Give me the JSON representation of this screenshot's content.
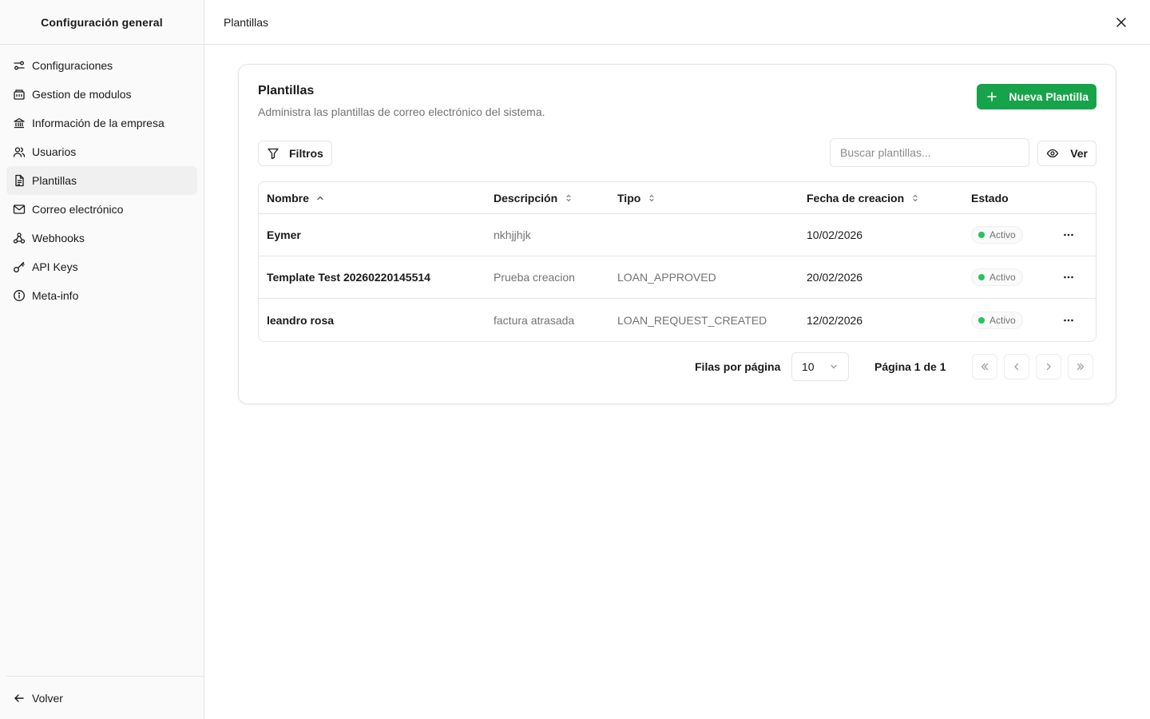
{
  "sidebar": {
    "title": "Configuración general",
    "items": [
      {
        "label": "Configuraciones",
        "icon": "settings-sliders-icon"
      },
      {
        "label": "Gestion de modulos",
        "icon": "modules-icon"
      },
      {
        "label": "Información de la empresa",
        "icon": "bank-building-icon"
      },
      {
        "label": "Usuarios",
        "icon": "users-icon"
      },
      {
        "label": "Plantillas",
        "icon": "file-text-icon"
      },
      {
        "label": "Correo electrónico",
        "icon": "mail-icon"
      },
      {
        "label": "Webhooks",
        "icon": "webhook-icon"
      },
      {
        "label": "API Keys",
        "icon": "key-icon"
      },
      {
        "label": "Meta-info",
        "icon": "info-icon"
      }
    ],
    "active_item": "Plantillas",
    "back_label": "Volver"
  },
  "topbar": {
    "title": "Plantillas"
  },
  "card": {
    "title": "Plantillas",
    "subtitle": "Administra las plantillas de correo electrónico del sistema.",
    "new_button_label": "Nueva Plantilla",
    "filters_label": "Filtros",
    "search_placeholder": "Buscar plantillas...",
    "view_label": "Ver"
  },
  "table": {
    "columns": [
      "Nombre",
      "Descripción",
      "Tipo",
      "Fecha de creacion",
      "Estado"
    ],
    "rows": [
      {
        "name": "Eymer",
        "description": "nkhjjhjk",
        "type": "",
        "date": "10/02/2026",
        "status": "Activo"
      },
      {
        "name": "Template Test 20260220145514",
        "description": "Prueba creacion",
        "type": "LOAN_APPROVED",
        "date": "20/02/2026",
        "status": "Activo"
      },
      {
        "name": "leandro rosa",
        "description": "factura atrasada",
        "type": "LOAN_REQUEST_CREATED",
        "date": "12/02/2026",
        "status": "Activo"
      }
    ]
  },
  "pagination": {
    "rows_per_page_label": "Filas por página",
    "rows_per_page_value": "10",
    "page_info": "Página 1 de 1"
  },
  "colors": {
    "accent": "#16a34a",
    "status_active": "#22c55e"
  }
}
